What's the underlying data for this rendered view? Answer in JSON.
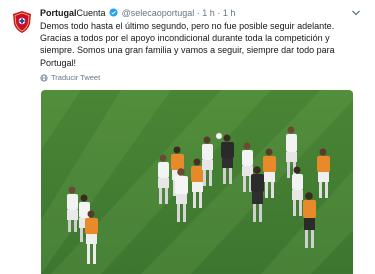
{
  "tweet": {
    "display_name": "Portugal",
    "suffix_label": "Cuenta",
    "handle": "@selecaoportugal",
    "separator": "·",
    "time": "1 h",
    "text": "Demos todo hasta el último segundo, pero no fue posible seguir adelante. Gracias a todos por el apoyo incondicional durante toda la competición y siempre. Somos una gran familia y vamos a seguir, siempre dar todo para Portugal!",
    "translate_label": "Traducir Tweet",
    "avatar_icon": "portugal-federation-crest",
    "more_icon": "chevron-down-icon"
  },
  "photo": {
    "subject": "team-players-on-pitch",
    "pitch_color": "#4f8a3a"
  },
  "colors": {
    "text": "#14171a",
    "secondary": "#657786",
    "verified": "#1da1f2",
    "crest_red": "#c8102e"
  }
}
